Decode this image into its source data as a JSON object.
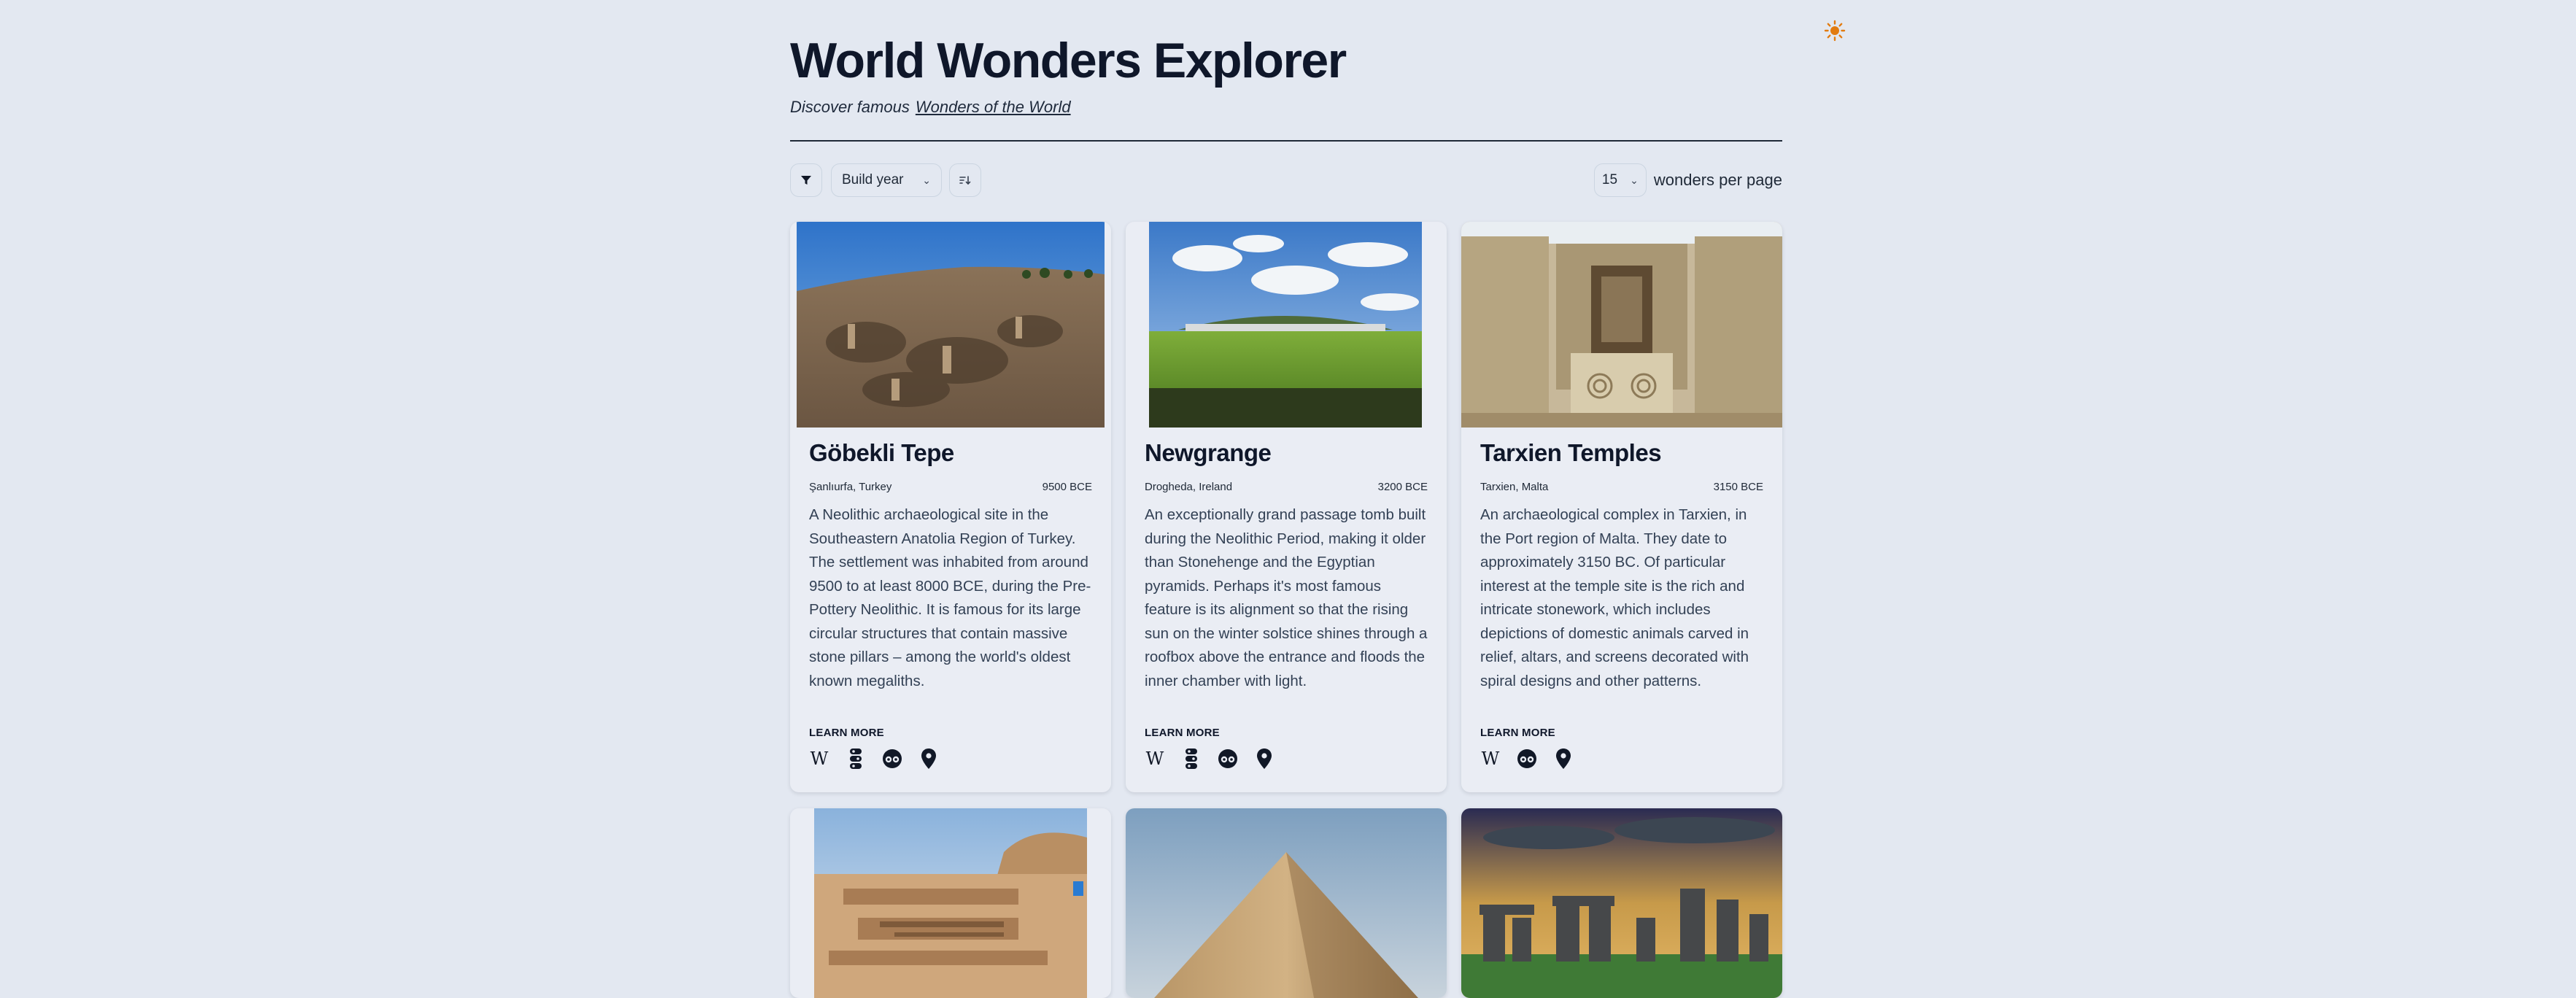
{
  "header": {
    "title": "World Wonders Explorer",
    "subtitle_prefix": "Discover famous",
    "subtitle_link": "Wonders of the World",
    "theme_toggle_icon": "sun-icon"
  },
  "controls": {
    "filter_icon": "funnel-icon",
    "sort_by": "Build year",
    "sort_direction_icon": "sort-order-icon",
    "per_page_value": "15",
    "per_page_label": "wonders per page"
  },
  "cards": [
    {
      "name": "Göbekli Tepe",
      "location": "Şanlıurfa, Turkey",
      "year": "9500 BCE",
      "description": "A Neolithic archaeological site in the Southeastern Anatolia Region of Turkey. The settlement was inhabited from around 9500 to at least 8000 BCE, during the Pre-Pottery Neolithic. It is famous for its large circular structures that contain massive stone pillars – among the world's oldest known megaliths.",
      "learn_more": "LEARN MORE",
      "links": [
        "wikipedia-icon",
        "google-arts-icon",
        "tripadvisor-icon",
        "map-pin-icon"
      ]
    },
    {
      "name": "Newgrange",
      "location": "Drogheda, Ireland",
      "year": "3200 BCE",
      "description": "An exceptionally grand passage tomb built during the Neolithic Period, making it older than Stonehenge and the Egyptian pyramids. Perhaps it's most famous feature is its alignment so that the rising sun on the winter solstice shines through a roofbox above the entrance and floods the inner chamber with light.",
      "learn_more": "LEARN MORE",
      "links": [
        "wikipedia-icon",
        "google-arts-icon",
        "tripadvisor-icon",
        "map-pin-icon"
      ]
    },
    {
      "name": "Tarxien Temples",
      "location": "Tarxien, Malta",
      "year": "3150 BCE",
      "description": "An archaeological complex in Tarxien, in the Port region of Malta. They date to approximately 3150 BC. Of particular interest at the temple site is the rich and intricate stonework, which includes depictions of domestic animals carved in relief, altars, and screens decorated with spiral designs and other patterns.",
      "learn_more": "LEARN MORE",
      "links": [
        "wikipedia-icon",
        "tripadvisor-icon",
        "map-pin-icon"
      ]
    }
  ],
  "second_row_images": [
    "mohenjo-daro-photo",
    "great-pyramid-photo",
    "stonehenge-photo"
  ]
}
